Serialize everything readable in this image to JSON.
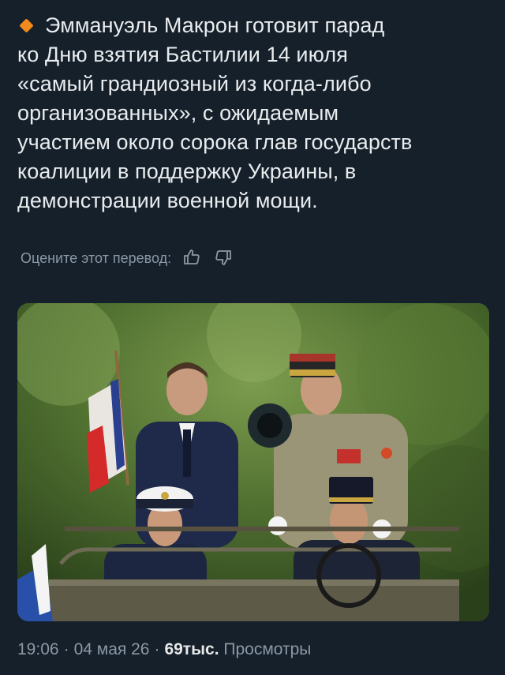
{
  "post": {
    "text_line1": "Эммануэль Макрон готовит парад",
    "text_line2": "ко Дню взятия Бастилии 14 июля",
    "text_line3": "«самый грандиозный из когда-либо",
    "text_line4": "организованных», с ожидаемым",
    "text_line5": "участием около сорока глав государств",
    "text_line6": "коалиции в поддержку Украины, в",
    "text_line7": "демонстрации военной мощи.",
    "bullet_icon": "orange-diamond-icon",
    "accent_color": "#f28a1c"
  },
  "translation_rating": {
    "label": "Оцените этот перевод:",
    "like_icon": "thumbs-up-icon",
    "dislike_icon": "thumbs-down-icon"
  },
  "meta": {
    "time": "19:06",
    "separator": "·",
    "date": "04 мая 26",
    "views_count": "69тыс.",
    "views_label": "Просмотры"
  }
}
